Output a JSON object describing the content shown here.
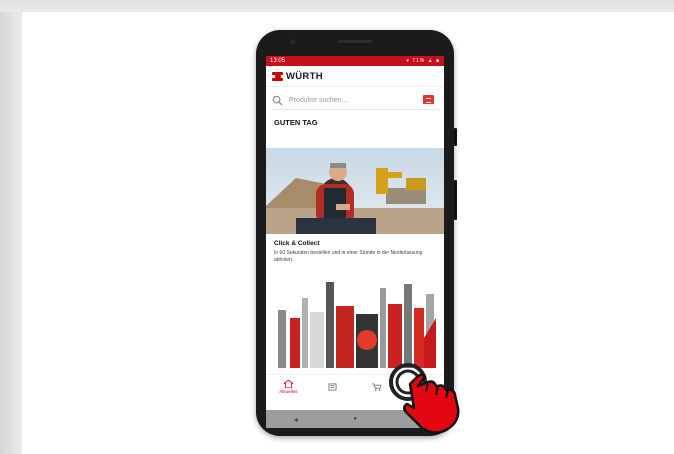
{
  "status": {
    "time": "13:05",
    "indicators": "▾ 71% ▲ ■"
  },
  "app": {
    "brand": "WÜRTH",
    "brand_color": "#cc0000"
  },
  "search": {
    "placeholder": "Produkte suchen..."
  },
  "home": {
    "greeting": "GUTEN TAG"
  },
  "promo": {
    "title": "Click & Collect",
    "text": "In 60 Sekunden bestellen und in einer Stunde in der Niederlassung abholen."
  },
  "nav": {
    "tabs": [
      {
        "label": "Aktuelles",
        "icon": "home-icon",
        "active": true
      },
      {
        "icon": "catalog-icon"
      },
      {
        "icon": "cart-icon"
      },
      {
        "icon": "account-icon"
      }
    ]
  },
  "system_nav": {
    "back": "◂",
    "home": "●",
    "recents": "■"
  }
}
